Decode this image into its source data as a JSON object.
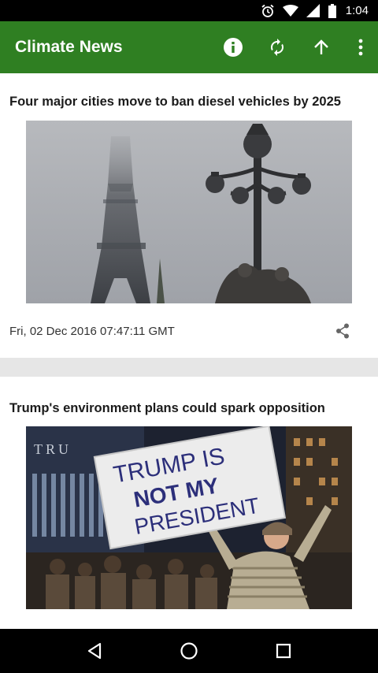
{
  "status_bar": {
    "time": "1:04",
    "icons": [
      "alarm-icon",
      "wifi-icon",
      "signal-icon",
      "battery-icon"
    ]
  },
  "app_bar": {
    "title": "Climate News",
    "background": "#2f7f22",
    "actions": [
      "info-icon",
      "refresh-icon",
      "arrow-up-icon",
      "more-vert-icon"
    ]
  },
  "feed": {
    "articles": [
      {
        "title": "Four major cities move to ban diesel vehicles by 2025",
        "date": "Fri, 02 Dec 2016 07:47:11 GMT",
        "image": "eiffel-tower-fog-photo"
      },
      {
        "title": "Trump's environment plans could spark opposition",
        "image": "protest-photo",
        "sign_text": [
          "TRUMP IS",
          "NOT MY",
          "PRESIDENT"
        ],
        "building_text": "TRU"
      }
    ]
  },
  "nav_bar": {
    "buttons": [
      "back-icon",
      "home-icon",
      "recents-icon"
    ]
  }
}
